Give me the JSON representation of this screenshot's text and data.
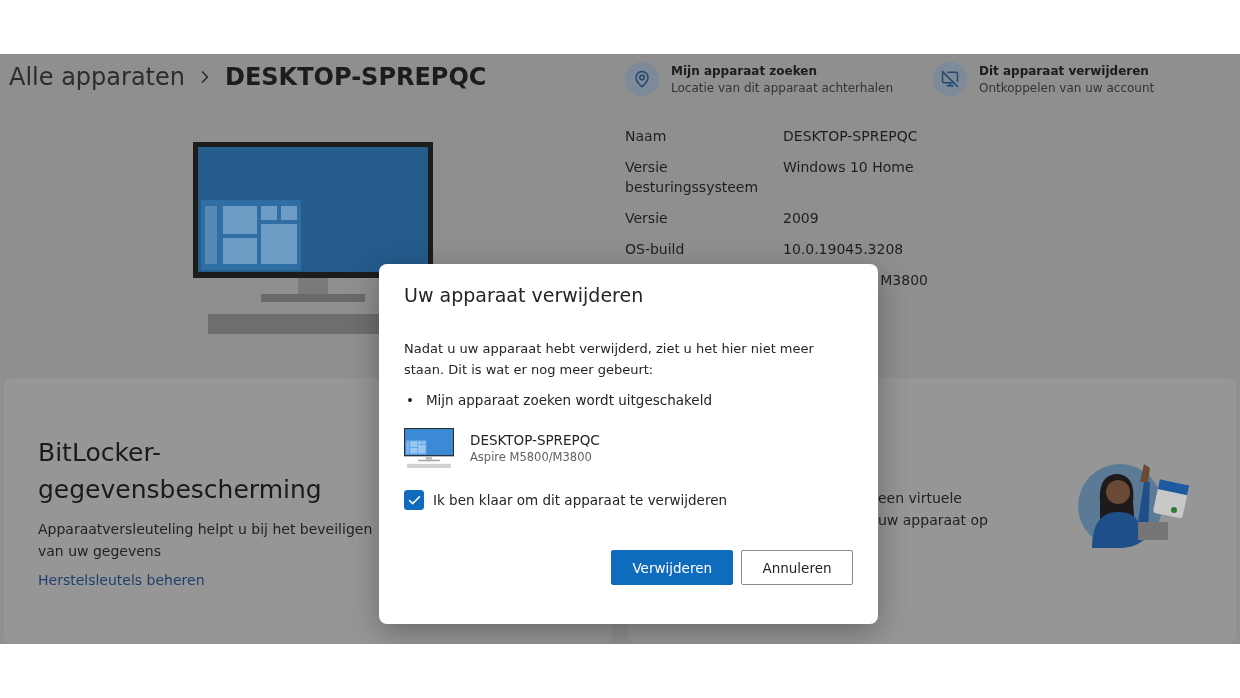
{
  "breadcrumb": {
    "parent": "Alle apparaten",
    "current": "DESKTOP-SPREPQC"
  },
  "actions": [
    {
      "kind": "locate",
      "title": "Mijn apparaat zoeken",
      "subtitle": "Locatie van dit apparaat achterhalen"
    },
    {
      "kind": "remove",
      "title": "Dit apparaat verwijderen",
      "subtitle": "Ontkoppelen van uw account"
    }
  ],
  "details": [
    {
      "label": "Naam",
      "value": "DESKTOP-SPREPQC"
    },
    {
      "label": "Versie besturingssysteem",
      "value": "Windows 10 Home"
    },
    {
      "label": "Versie",
      "value": "2009"
    },
    {
      "label": "OS-build",
      "value": "10.0.19045.3208"
    },
    {
      "value": "M3800"
    }
  ],
  "cards": [
    {
      "kind": "bitlocker",
      "title": "BitLocker-gegevensbescherming",
      "text": "Apparaatversleuteling helpt u bij het beveiligen van uw gegevens",
      "link": "Herstelsleutels beheren"
    },
    {
      "kind": "illustrated",
      "lines": [
        "een virtuele",
        "uw apparaat op"
      ]
    }
  ],
  "dialog": {
    "title": "Uw apparaat verwijderen",
    "intro": "Nadat u uw apparaat hebt verwijderd, ziet u het hier niet meer staan. Dit is wat er nog meer gebeurt:",
    "bullets": [
      {
        "marker": "•",
        "text": "Mijn apparaat zoeken wordt uitgeschakeld"
      }
    ],
    "device": {
      "name": "DESKTOP-SPREPQC",
      "model": "Aspire M5800/M3800"
    },
    "checkbox": {
      "label": "Ik ben klaar om dit apparaat te verwijderen",
      "checked": true
    },
    "buttons": [
      {
        "label": "Verwijderen",
        "primary": true
      },
      {
        "label": "Annuleren",
        "primary": false
      }
    ]
  }
}
